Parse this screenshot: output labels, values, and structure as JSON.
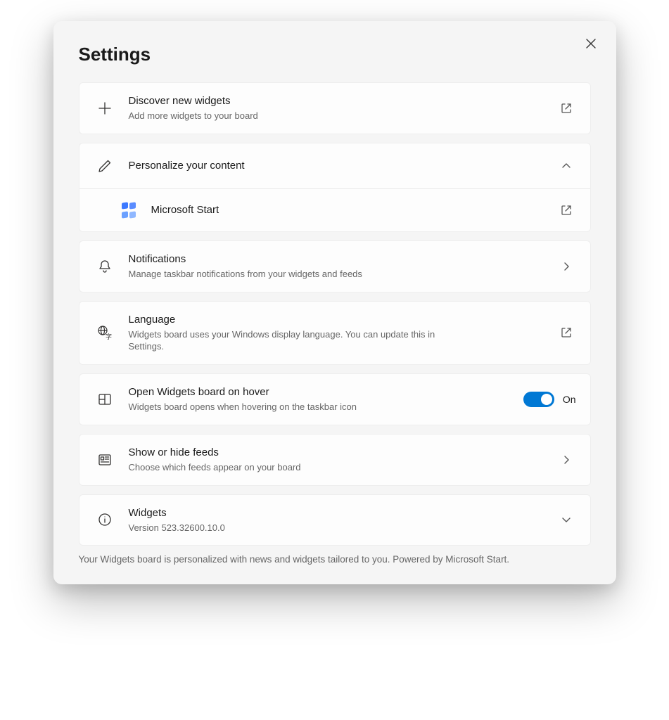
{
  "title": "Settings",
  "rows": {
    "discover": {
      "title": "Discover new widgets",
      "desc": "Add more widgets to your board"
    },
    "personalize": {
      "title": "Personalize your content",
      "ms_start": "Microsoft Start"
    },
    "notifications": {
      "title": "Notifications",
      "desc": "Manage taskbar notifications from your widgets and feeds"
    },
    "language": {
      "title": "Language",
      "desc": "Widgets board uses your Windows display language. You can update this in Settings."
    },
    "hover": {
      "title": "Open Widgets board on hover",
      "desc": "Widgets board opens when hovering on the taskbar icon",
      "toggle_state": "On"
    },
    "feeds": {
      "title": "Show or hide feeds",
      "desc": "Choose which feeds appear on your board"
    },
    "about": {
      "title": "Widgets",
      "desc": "Version 523.32600.10.0"
    }
  },
  "footer": "Your Widgets board is personalized with news and widgets tailored to you. Powered by Microsoft Start."
}
